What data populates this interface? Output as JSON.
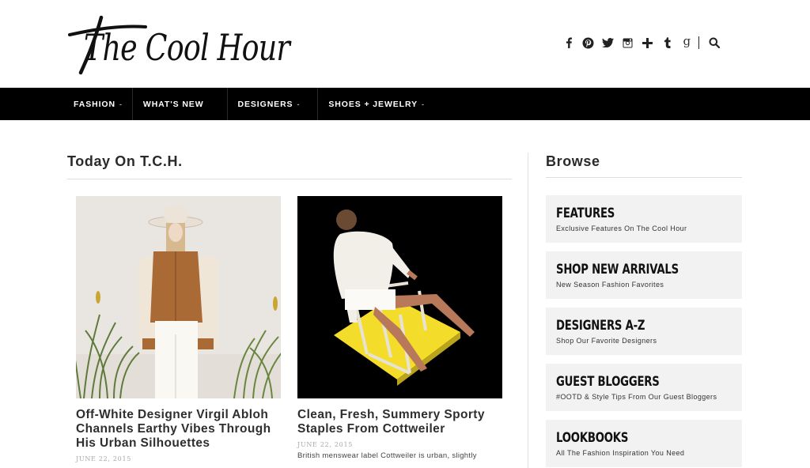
{
  "header": {
    "logo_text": "The Cool Hour",
    "socials": [
      {
        "icon": "facebook-icon",
        "glyph": "f"
      },
      {
        "icon": "pinterest-icon",
        "glyph": "p"
      },
      {
        "icon": "twitter-icon",
        "glyph": "t"
      },
      {
        "icon": "instagram-icon",
        "glyph": "i"
      },
      {
        "icon": "bloglovin-plus-icon",
        "glyph": "+"
      },
      {
        "icon": "tumblr-icon",
        "glyph": "t"
      },
      {
        "icon": "google-plus-icon",
        "glyph": "g"
      },
      {
        "icon": "search-icon",
        "glyph": "search"
      }
    ]
  },
  "nav": {
    "items": [
      {
        "label": "FASHION",
        "has_caret": true
      },
      {
        "label": "WHAT'S NEW",
        "has_caret": false
      },
      {
        "label": "DESIGNERS",
        "has_caret": true
      },
      {
        "label": "SHOES + JEWELRY",
        "has_caret": true
      }
    ],
    "caret": "-"
  },
  "main": {
    "section_title": "Today On T.C.H.",
    "cards": [
      {
        "title": "Off-White Designer Virgil Abloh Channels Earthy Vibes Through His Urban Silhouettes",
        "date": "JUNE 22, 2015",
        "excerpt": ""
      },
      {
        "title": "Clean, Fresh, Summery Sporty Staples From Cottweiler",
        "date": "JUNE 22, 2015",
        "excerpt": "British menswear label Cottweiler is urban, slightly"
      }
    ]
  },
  "sidebar": {
    "title": "Browse",
    "items": [
      {
        "name": "FEATURES",
        "sub": "Exclusive Features On The Cool Hour"
      },
      {
        "name": "SHOP NEW ARRIVALS",
        "sub": "New Season Fashion Favorites"
      },
      {
        "name": "DESIGNERS A-Z",
        "sub": "Shop Our Favorite Designers"
      },
      {
        "name": "GUEST BLOGGERS",
        "sub": "#OOTD & Style Tips From Our Guest Bloggers"
      },
      {
        "name": "LOOKBOOKS",
        "sub": "All The Fashion Inspiration You Need"
      }
    ]
  },
  "colors": {
    "nav_bg": "#000000",
    "card_bg": "#f2f2f2",
    "accent_yellow": "#f5d900"
  }
}
